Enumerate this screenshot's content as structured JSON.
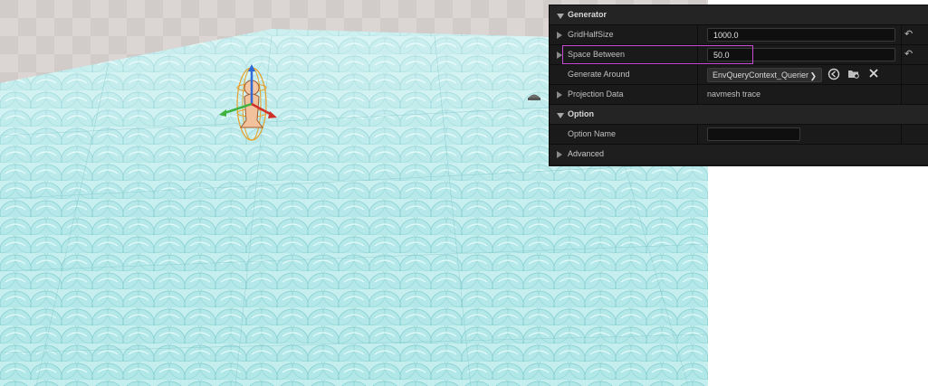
{
  "details_panel": {
    "generator": {
      "label": "Generator",
      "grid_half_size": {
        "label": "GridHalfSize",
        "value": "1000.0"
      },
      "space_between": {
        "label": "Space Between",
        "value": "50.0"
      },
      "generate_around": {
        "label": "Generate Around",
        "value": "EnvQueryContext_Querier"
      },
      "projection_data": {
        "label": "Projection Data",
        "value": "navmesh trace"
      }
    },
    "option": {
      "label": "Option",
      "option_name": {
        "label": "Option Name",
        "value": ""
      }
    },
    "advanced": {
      "label": "Advanced"
    }
  },
  "icons": {
    "reset": "reset-arrow-icon",
    "browse": "browse-icon",
    "folder": "folder-search-icon",
    "clear": "close-icon",
    "chevron": "chevron-down-icon"
  },
  "colors": {
    "highlight": "#c84bd6",
    "sphere": "#b6ecec",
    "panel_bg": "#151515"
  }
}
